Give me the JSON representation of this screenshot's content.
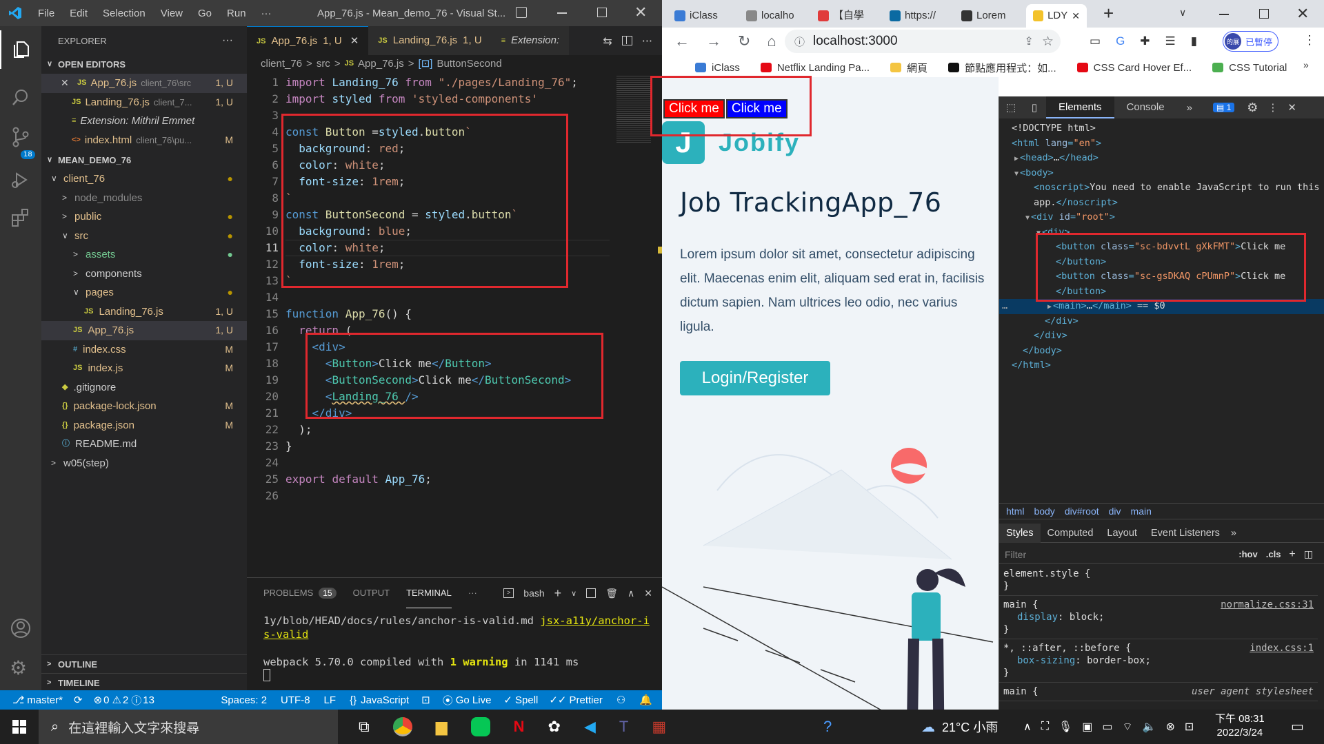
{
  "vscode": {
    "title": "App_76.js - Mean_demo_76 - Visual St...",
    "menu": [
      "File",
      "Edit",
      "Selection",
      "View",
      "Go",
      "Run",
      "···"
    ],
    "activity_badge": "18",
    "explorer": {
      "title": "EXPLORER",
      "open_editors_label": "OPEN EDITORS",
      "open_editors": [
        {
          "icon": "JS",
          "name": "App_76.js",
          "path": "client_76\\src",
          "status": "1, U",
          "active": true,
          "close": true
        },
        {
          "icon": "JS",
          "name": "Landing_76.js",
          "path": "client_7...",
          "status": "1, U"
        },
        {
          "icon": "≡",
          "name": "Extension: Mithril Emmet",
          "path": "",
          "status": ""
        },
        {
          "icon": "<>",
          "name": "index.html",
          "path": "client_76\\pu...",
          "status": "M"
        }
      ],
      "project_label": "MEAN_DEMO_76",
      "tree": [
        {
          "indent": 1,
          "arrow": "∨",
          "name": "client_76",
          "status": "●",
          "scolor": "#b89500",
          "ncolor": "#e2c08d"
        },
        {
          "indent": 2,
          "arrow": ">",
          "name": "node_modules",
          "status": "",
          "ncolor": "#8c8c8c"
        },
        {
          "indent": 2,
          "arrow": ">",
          "name": "public",
          "status": "●",
          "scolor": "#b89500",
          "ncolor": "#e2c08d"
        },
        {
          "indent": 2,
          "arrow": "∨",
          "name": "src",
          "status": "●",
          "scolor": "#b89500",
          "ncolor": "#e2c08d"
        },
        {
          "indent": 3,
          "arrow": ">",
          "name": "assets",
          "status": "●",
          "scolor": "#73c991",
          "ncolor": "#73c991"
        },
        {
          "indent": 3,
          "arrow": ">",
          "name": "components",
          "status": "",
          "ncolor": "#ccc"
        },
        {
          "indent": 3,
          "arrow": "∨",
          "name": "pages",
          "status": "●",
          "scolor": "#b89500",
          "ncolor": "#e2c08d"
        },
        {
          "indent": 4,
          "icon": "JS",
          "name": "Landing_76.js",
          "status": "1, U",
          "scolor": "#e2c08d",
          "ncolor": "#e2c08d"
        },
        {
          "indent": 3,
          "icon": "JS",
          "name": "App_76.js",
          "status": "1, U",
          "scolor": "#e2c08d",
          "ncolor": "#e2c08d",
          "selected": true
        },
        {
          "indent": 3,
          "icon": "#",
          "name": "index.css",
          "status": "M",
          "scolor": "#e2c08d",
          "ncolor": "#e2c08d"
        },
        {
          "indent": 3,
          "icon": "JS",
          "name": "index.js",
          "status": "M",
          "scolor": "#e2c08d",
          "ncolor": "#e2c08d"
        },
        {
          "indent": 2,
          "icon": "◆",
          "name": ".gitignore",
          "status": "",
          "ncolor": "#ccc"
        },
        {
          "indent": 2,
          "icon": "{}",
          "name": "package-lock.json",
          "status": "M",
          "scolor": "#e2c08d",
          "ncolor": "#e2c08d"
        },
        {
          "indent": 2,
          "icon": "{}",
          "name": "package.json",
          "status": "M",
          "scolor": "#e2c08d",
          "ncolor": "#e2c08d"
        },
        {
          "indent": 2,
          "icon": "ⓘ",
          "name": "README.md",
          "status": "",
          "ncolor": "#ccc"
        },
        {
          "indent": 1,
          "arrow": ">",
          "name": "w05(step)",
          "status": "",
          "ncolor": "#ccc"
        }
      ],
      "outline_label": "OUTLINE",
      "timeline_label": "TIMELINE"
    },
    "tabs": [
      {
        "icon": "JS",
        "label": "App_76.js",
        "status": "1, U",
        "active": true
      },
      {
        "icon": "JS",
        "label": "Landing_76.js",
        "status": "1, U",
        "active": false
      },
      {
        "icon": "≡",
        "label": "Extension:",
        "active": false
      }
    ],
    "breadcrumb": [
      "client_76",
      "src",
      "App_76.js",
      "ButtonSecond"
    ],
    "code": [
      [
        [
          "kw",
          "import "
        ],
        [
          "id",
          "Landing_76 "
        ],
        [
          "kw",
          "from "
        ],
        [
          "str",
          "\"./pages/Landing_76\""
        ],
        [
          "txt",
          ";"
        ]
      ],
      [
        [
          "kw",
          "import "
        ],
        [
          "id",
          "styled "
        ],
        [
          "kw",
          "from "
        ],
        [
          "str",
          "'styled-components'"
        ]
      ],
      [],
      [
        [
          "tag",
          "const "
        ],
        [
          "fn",
          "Button "
        ],
        [
          "txt",
          "="
        ],
        [
          "id",
          "styled"
        ],
        [
          "txt",
          "."
        ],
        [
          "fn",
          "button"
        ],
        [
          "str",
          "`"
        ]
      ],
      [
        [
          "str",
          "  "
        ],
        [
          "cssp",
          "background"
        ],
        [
          "txt",
          ": "
        ],
        [
          "str",
          "red"
        ],
        [
          "txt",
          ";"
        ]
      ],
      [
        [
          "str",
          "  "
        ],
        [
          "cssp",
          "color"
        ],
        [
          "txt",
          ": "
        ],
        [
          "str",
          "white"
        ],
        [
          "txt",
          ";"
        ]
      ],
      [
        [
          "str",
          "  "
        ],
        [
          "cssp",
          "font-size"
        ],
        [
          "txt",
          ": "
        ],
        [
          "str",
          "1rem"
        ],
        [
          "txt",
          ";"
        ]
      ],
      [
        [
          "str",
          "`"
        ]
      ],
      [
        [
          "tag",
          "const "
        ],
        [
          "fn",
          "ButtonSecond "
        ],
        [
          "txt",
          "= "
        ],
        [
          "id",
          "styled"
        ],
        [
          "txt",
          "."
        ],
        [
          "fn",
          "button"
        ],
        [
          "str",
          "`"
        ]
      ],
      [
        [
          "str",
          "  "
        ],
        [
          "cssp",
          "background"
        ],
        [
          "txt",
          ": "
        ],
        [
          "str",
          "blue"
        ],
        [
          "txt",
          ";"
        ]
      ],
      [
        [
          "str",
          "  "
        ],
        [
          "cssp",
          "color"
        ],
        [
          "txt",
          ": "
        ],
        [
          "str",
          "white"
        ],
        [
          "txt",
          ";"
        ]
      ],
      [
        [
          "str",
          "  "
        ],
        [
          "cssp",
          "font-size"
        ],
        [
          "txt",
          ": "
        ],
        [
          "str",
          "1rem"
        ],
        [
          "txt",
          ";"
        ]
      ],
      [
        [
          "str",
          "`"
        ]
      ],
      [],
      [
        [
          "tag",
          "function "
        ],
        [
          "fn",
          "App_76"
        ],
        [
          "txt",
          "() {"
        ]
      ],
      [
        [
          "txt",
          "  "
        ],
        [
          "kw",
          "return "
        ],
        [
          "txt",
          "("
        ]
      ],
      [
        [
          "txt",
          "    "
        ],
        [
          "tag",
          "<"
        ],
        [
          "tag",
          "div"
        ],
        [
          "tag",
          ">"
        ]
      ],
      [
        [
          "txt",
          "      "
        ],
        [
          "tag",
          "<"
        ],
        [
          "cmp",
          "Button"
        ],
        [
          "tag",
          ">"
        ],
        [
          "txt",
          "Click me"
        ],
        [
          "tag",
          "</"
        ],
        [
          "cmp",
          "Button"
        ],
        [
          "tag",
          ">"
        ]
      ],
      [
        [
          "txt",
          "      "
        ],
        [
          "tag",
          "<"
        ],
        [
          "cmp",
          "ButtonSecond"
        ],
        [
          "tag",
          ">"
        ],
        [
          "txt",
          "Click me"
        ],
        [
          "tag",
          "</"
        ],
        [
          "cmp",
          "ButtonSecond"
        ],
        [
          "tag",
          ">"
        ]
      ],
      [
        [
          "txt",
          "      "
        ],
        [
          "tag",
          "<"
        ],
        [
          "cmp",
          "Landing_76 "
        ],
        [
          "tag",
          "/>"
        ]
      ],
      [
        [
          "txt",
          "    "
        ],
        [
          "tag",
          "</"
        ],
        [
          "tag",
          "div"
        ],
        [
          "tag",
          ">"
        ]
      ],
      [
        [
          "txt",
          "  );"
        ]
      ],
      [
        [
          "txt",
          "}"
        ]
      ],
      [],
      [
        [
          "kw",
          "export "
        ],
        [
          "kw",
          "default "
        ],
        [
          "id",
          "App_76"
        ],
        [
          "txt",
          ";"
        ]
      ],
      []
    ],
    "panel": {
      "tabs": [
        "PROBLEMS",
        "OUTPUT",
        "TERMINAL",
        "···"
      ],
      "problems_count": "15",
      "shell": "bash",
      "lines": [
        "1y/blob/HEAD/docs/rules/anchor-is-valid.md  jsx-a11y/anchor-i",
        "s-valid",
        "",
        "webpack 5.70.0 compiled with 1 warning in 1141 ms"
      ],
      "link_text_1": "jsx-a11y/anchor-i",
      "link_text_2": "s-valid",
      "warn_pre": "webpack 5.70.0 compiled with ",
      "warn_num": "1",
      "warn_word": " warning",
      "warn_post": " in 1141 ms"
    },
    "status": {
      "branch": "master*",
      "errors": "0",
      "warnings": "2",
      "infos": "13",
      "spaces": "Spaces: 2",
      "encoding": "UTF-8",
      "eol": "LF",
      "language": "JavaScript",
      "golive": "Go Live",
      "spell": "Spell",
      "prettier": "Prettier"
    }
  },
  "browser": {
    "tabs": [
      {
        "label": "iClass",
        "color": "#3a7bd5"
      },
      {
        "label": "localho",
        "color": "#888"
      },
      {
        "label": "【自學",
        "color": "#e03b3b"
      },
      {
        "label": "https://",
        "color": "#0b6aa2"
      },
      {
        "label": "Lorem",
        "color": "#333"
      },
      {
        "label": "LDY",
        "color": "#f3c22b",
        "active": true
      }
    ],
    "url": "localhost:3000",
    "profile_label": "已暫停",
    "profile_avatar": "的展",
    "bookmarks": [
      "iClass",
      "Netflix Landing Pa...",
      "網頁",
      "節點應用程式：如...",
      "CSS Card Hover Ef...",
      "CSS Tutorial"
    ],
    "page": {
      "button1": "Click me",
      "button2": "Click me",
      "logo_letter": "J",
      "logo_text": "Jobify",
      "heading": "Job TrackingApp_76",
      "body": "Lorem ipsum dolor sit amet, consectetur adipiscing elit. Maecenas enim elit, aliquam sed erat in, facilisis dictum sapien. Nam ultrices leo odio, nec varius ligula.",
      "cta": "Login/Register"
    },
    "devtools": {
      "tabs": [
        "Elements",
        "Console"
      ],
      "issues_count": "1",
      "dom": [
        {
          "d": 0,
          "parts": [
            [
              "dtxt",
              "<!DOCTYPE html>"
            ]
          ]
        },
        {
          "d": 0,
          "parts": [
            [
              "dtag",
              "<html "
            ],
            [
              "dattr",
              "lang"
            ],
            [
              "dtag",
              "="
            ],
            [
              "dval",
              "\"en\""
            ],
            [
              "dtag",
              ">"
            ]
          ]
        },
        {
          "d": 1,
          "arrow": "▶",
          "parts": [
            [
              "dtag",
              "<head>"
            ],
            [
              "dtxt",
              "…"
            ],
            [
              "dtag",
              "</head>"
            ]
          ]
        },
        {
          "d": 1,
          "arrow": "▼",
          "parts": [
            [
              "dtag",
              "<body>"
            ]
          ]
        },
        {
          "d": 2,
          "parts": [
            [
              "dtag",
              "<noscript>"
            ],
            [
              "dtxt",
              "You need to enable JavaScript to run this"
            ]
          ]
        },
        {
          "d": 2,
          "parts": [
            [
              "dtxt",
              "app."
            ],
            [
              "dtag",
              "</noscript>"
            ]
          ]
        },
        {
          "d": 2,
          "arrow": "▼",
          "parts": [
            [
              "dtag",
              "<div "
            ],
            [
              "dattr",
              "id"
            ],
            [
              "dtag",
              "="
            ],
            [
              "dval",
              "\"root\""
            ],
            [
              "dtag",
              ">"
            ]
          ]
        },
        {
          "d": 3,
          "arrow": "▼",
          "parts": [
            [
              "dtag",
              "<div>"
            ]
          ]
        },
        {
          "d": 4,
          "parts": [
            [
              "dtag",
              "<button "
            ],
            [
              "dattr",
              "class"
            ],
            [
              "dtag",
              "="
            ],
            [
              "dval",
              "\"sc-bdvvtL gXkFMT\""
            ],
            [
              "dtag",
              ">"
            ],
            [
              "dtxt",
              "Click me"
            ]
          ]
        },
        {
          "d": 4,
          "parts": [
            [
              "dtag",
              "</button>"
            ]
          ]
        },
        {
          "d": 4,
          "parts": [
            [
              "dtag",
              "<button "
            ],
            [
              "dattr",
              "class"
            ],
            [
              "dtag",
              "="
            ],
            [
              "dval",
              "\"sc-gsDKAQ cPUmnP\""
            ],
            [
              "dtag",
              ">"
            ],
            [
              "dtxt",
              "Click me"
            ]
          ]
        },
        {
          "d": 4,
          "parts": [
            [
              "dtag",
              "</button>"
            ]
          ]
        },
        {
          "d": 4,
          "arrow": "▶",
          "sel": true,
          "parts": [
            [
              "dtag",
              "<main>"
            ],
            [
              "dtxt",
              "…"
            ],
            [
              "dtag",
              "</main>"
            ],
            [
              "dtxt",
              " == $0"
            ]
          ]
        },
        {
          "d": 3,
          "parts": [
            [
              "dtag",
              "</div>"
            ]
          ]
        },
        {
          "d": 2,
          "parts": [
            [
              "dtag",
              "</div>"
            ]
          ]
        },
        {
          "d": 1,
          "parts": [
            [
              "dtag",
              "</body>"
            ]
          ]
        },
        {
          "d": 0,
          "parts": [
            [
              "dtag",
              "</html>"
            ]
          ]
        }
      ],
      "crumbs": [
        "html",
        "body",
        "div#root",
        "div",
        "main"
      ],
      "style_tabs": [
        "Styles",
        "Computed",
        "Layout",
        "Event Listeners"
      ],
      "filter_placeholder": "Filter",
      "hov": ":hov",
      "cls": ".cls",
      "rules": [
        {
          "sel": "element.style {",
          "src": "",
          "props": []
        },
        {
          "sel": "main {",
          "src": "normalize.css:31",
          "props": [
            [
              "display",
              "block"
            ]
          ]
        },
        {
          "sel": "*, ::after, ::before {",
          "src": "index.css:1",
          "props": [
            [
              "box-sizing",
              "border-box"
            ]
          ]
        },
        {
          "sel": "main {",
          "src": "user agent stylesheet",
          "props": []
        }
      ]
    }
  },
  "taskbar": {
    "search_placeholder": "在這裡輸入文字來搜尋",
    "weather": "21°C 小雨",
    "time": "下午 08:31",
    "date": "2022/3/24"
  },
  "colors": {
    "accent": "#007acc",
    "highlight": "#e0282e",
    "button1": "#ff0000",
    "button2": "#0000ff",
    "teal": "#2cb1bc"
  }
}
